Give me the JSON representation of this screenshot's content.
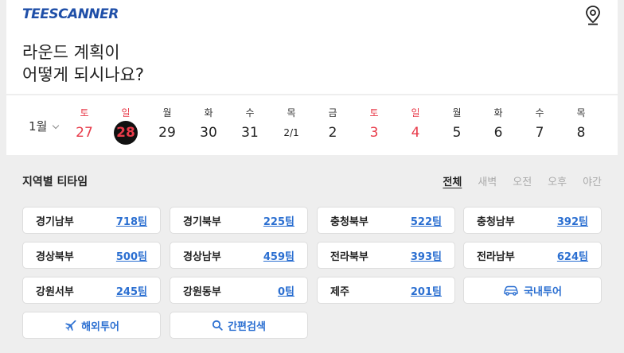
{
  "header": {
    "logo": "TEESCANNER",
    "location_icon": "location-pin-icon"
  },
  "headline": {
    "line1": "라운드 계획이",
    "line2": "어떻게 되시나요?"
  },
  "calendar": {
    "month": "1월",
    "days": [
      {
        "dow": "토",
        "num": "27",
        "red": true
      },
      {
        "dow": "일",
        "num": "28",
        "red": true,
        "selected": true
      },
      {
        "dow": "월",
        "num": "29"
      },
      {
        "dow": "화",
        "num": "30"
      },
      {
        "dow": "수",
        "num": "31"
      },
      {
        "dow": "목",
        "num": "2/1"
      },
      {
        "dow": "금",
        "num": "2"
      },
      {
        "dow": "토",
        "num": "3",
        "red": true
      },
      {
        "dow": "일",
        "num": "4",
        "red": true
      },
      {
        "dow": "월",
        "num": "5"
      },
      {
        "dow": "화",
        "num": "6"
      },
      {
        "dow": "수",
        "num": "7"
      },
      {
        "dow": "목",
        "num": "8"
      }
    ]
  },
  "regions": {
    "title": "지역별 티타임",
    "filters": [
      "전체",
      "새벽",
      "오전",
      "오후",
      "야간"
    ],
    "items": [
      {
        "name": "경기남부",
        "count": "718팀"
      },
      {
        "name": "경기북부",
        "count": "225팀"
      },
      {
        "name": "충청북부",
        "count": "522팀"
      },
      {
        "name": "충청남부",
        "count": "392팀"
      },
      {
        "name": "경상북부",
        "count": "500팀"
      },
      {
        "name": "경상남부",
        "count": "459팀"
      },
      {
        "name": "전라북부",
        "count": "393팀"
      },
      {
        "name": "전라남부",
        "count": "624팀"
      },
      {
        "name": "강원서부",
        "count": "245팀"
      },
      {
        "name": "강원동부",
        "count": "0팀"
      },
      {
        "name": "제주",
        "count": "201팀"
      }
    ],
    "domestic_tour": "국내투어",
    "overseas_tour": "해외투어",
    "quick_search": "간편검색"
  },
  "colors": {
    "accent": "#2b6fd1",
    "holiday": "#e83b4a",
    "logo": "#1f4fa8"
  }
}
